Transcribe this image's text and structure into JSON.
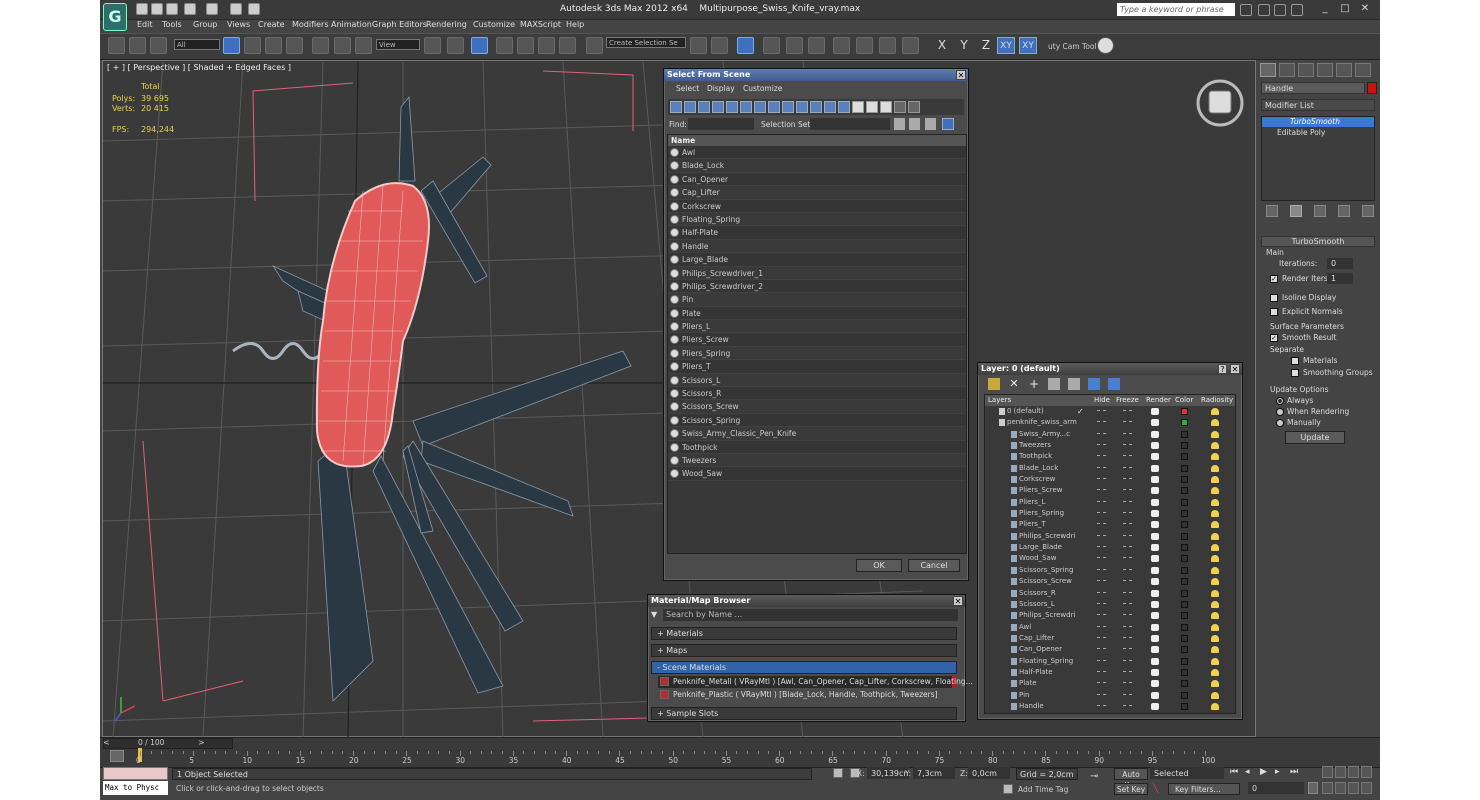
{
  "window": {
    "app_title": "Autodesk 3ds Max  2012 x64",
    "file_name": "Multipurpose_Swiss_Knife_vray.max",
    "search_placeholder": "Type a keyword or phrase"
  },
  "menu": [
    "Edit",
    "Tools",
    "Group",
    "Views",
    "Create",
    "Modifiers",
    "Animation",
    "Graph Editors",
    "Rendering",
    "Customize",
    "MAXScript",
    "Help"
  ],
  "toolbar": {
    "selection_filter": "All",
    "ref_coord": "View",
    "named_selection": "Create Selection Se",
    "axes": [
      "X",
      "Y",
      "Z",
      "XY",
      "XY"
    ],
    "cam_tool": "uty Cam Tool"
  },
  "viewport": {
    "label": "[ + ] [ Perspective ] [ Shaded + Edged Faces ]",
    "stats_header": "Total",
    "polys_label": "Polys:",
    "polys": "39 695",
    "verts_label": "Verts:",
    "verts": "20 415",
    "fps_label": "FPS:",
    "fps": "294,244"
  },
  "command_panel": {
    "object_name": "Handle",
    "modifier_list": "Modifier List",
    "stack": [
      "TurboSmooth",
      "Editable Poly"
    ],
    "rollout_title": "TurboSmooth",
    "main_label": "Main",
    "iterations_label": "Iterations:",
    "iterations": "0",
    "render_iters_label": "Render Iters:",
    "render_iters": "1",
    "isoline": "Isoline Display",
    "explicit": "Explicit Normals",
    "surface_label": "Surface Parameters",
    "smooth_result": "Smooth Result",
    "separate_label": "Separate",
    "materials": "Materials",
    "smoothing_groups": "Smoothing Groups",
    "update_label": "Update Options",
    "always": "Always",
    "when_rendering": "When Rendering",
    "manually": "Manually",
    "update_btn": "Update"
  },
  "select_dialog": {
    "title": "Select From Scene",
    "menus": [
      "Select",
      "Display",
      "Customize"
    ],
    "find_label": "Find:",
    "selection_set_label": "Selection Set:",
    "column": "Name",
    "items": [
      "Awl",
      "Blade_Lock",
      "Can_Opener",
      "Cap_Lifter",
      "Corkscrew",
      "Floating_Spring",
      "Half-Plate",
      "Handle",
      "Large_Blade",
      "Philips_Screwdriver_1",
      "Philips_Screwdriver_2",
      "Pin",
      "Plate",
      "Pliers_L",
      "Pliers_Screw",
      "Pliers_Spring",
      "Pliers_T",
      "Scissors_L",
      "Scissors_R",
      "Scissors_Screw",
      "Scissors_Spring",
      "Swiss_Army_Classic_Pen_Knife",
      "Toothpick",
      "Tweezers",
      "Wood_Saw"
    ],
    "ok": "OK",
    "cancel": "Cancel"
  },
  "layer_dialog": {
    "title": "Layer: 0 (default)",
    "columns": [
      "Layers",
      "Hide",
      "Freeze",
      "Render",
      "Color",
      "Radiosity"
    ],
    "layers": [
      {
        "name": "0 (default)",
        "color": "#e03030"
      },
      {
        "name": "penknife_swiss_arm",
        "color": "#30b030"
      }
    ],
    "objects": [
      "Swiss_Army...c",
      "Tweezers",
      "Toothpick",
      "Blade_Lock",
      "Corkscrew",
      "Pliers_Screw",
      "Pliers_L",
      "Pliers_Spring",
      "Pliers_T",
      "Philips_Screwdri",
      "Large_Blade",
      "Wood_Saw",
      "Scissors_Spring",
      "Scissors_Screw",
      "Scissors_R",
      "Scissors_L",
      "Philips_Screwdri",
      "Awl",
      "Cap_Lifter",
      "Can_Opener",
      "Floating_Spring",
      "Half-Plate",
      "Plate",
      "Pin",
      "Handle"
    ]
  },
  "material_browser": {
    "title": "Material/Map Browser",
    "search": "Search by Name ...",
    "sections": [
      "+ Materials",
      "+ Maps",
      "- Scene Materials",
      "+ Sample Slots"
    ],
    "materials": [
      "Penknife_Metall  ( VRayMtl ) [Awl, Can_Opener, Cap_Lifter, Corkscrew, Floating...",
      "Penknife_Plastic  ( VRayMtl ) [Blade_Lock, Handle, Toothpick, Tweezers]"
    ]
  },
  "timeline": {
    "frame": "0 / 100",
    "ticks": [
      "0",
      "5",
      "10",
      "15",
      "20",
      "25",
      "30",
      "35",
      "40",
      "45",
      "50",
      "55",
      "60",
      "65",
      "70",
      "75",
      "80",
      "85",
      "90",
      "95",
      "100"
    ]
  },
  "status": {
    "script_listener": "Max to Physc",
    "selected": "1 Object Selected",
    "prompt": "Click or click-and-drag to select objects",
    "x_label": "X:",
    "x": "30,139cm",
    "y_label": "Y:",
    "y": "7,3cm",
    "z_label": "Z:",
    "z": "0,0cm",
    "grid": "Grid = 2,0cm",
    "add_time_tag": "Add Time Tag",
    "auto_key": "Auto Key",
    "set_key": "Set Key",
    "key_mode": "Selected",
    "key_filters": "Key Filters...",
    "frame_field": "0"
  }
}
